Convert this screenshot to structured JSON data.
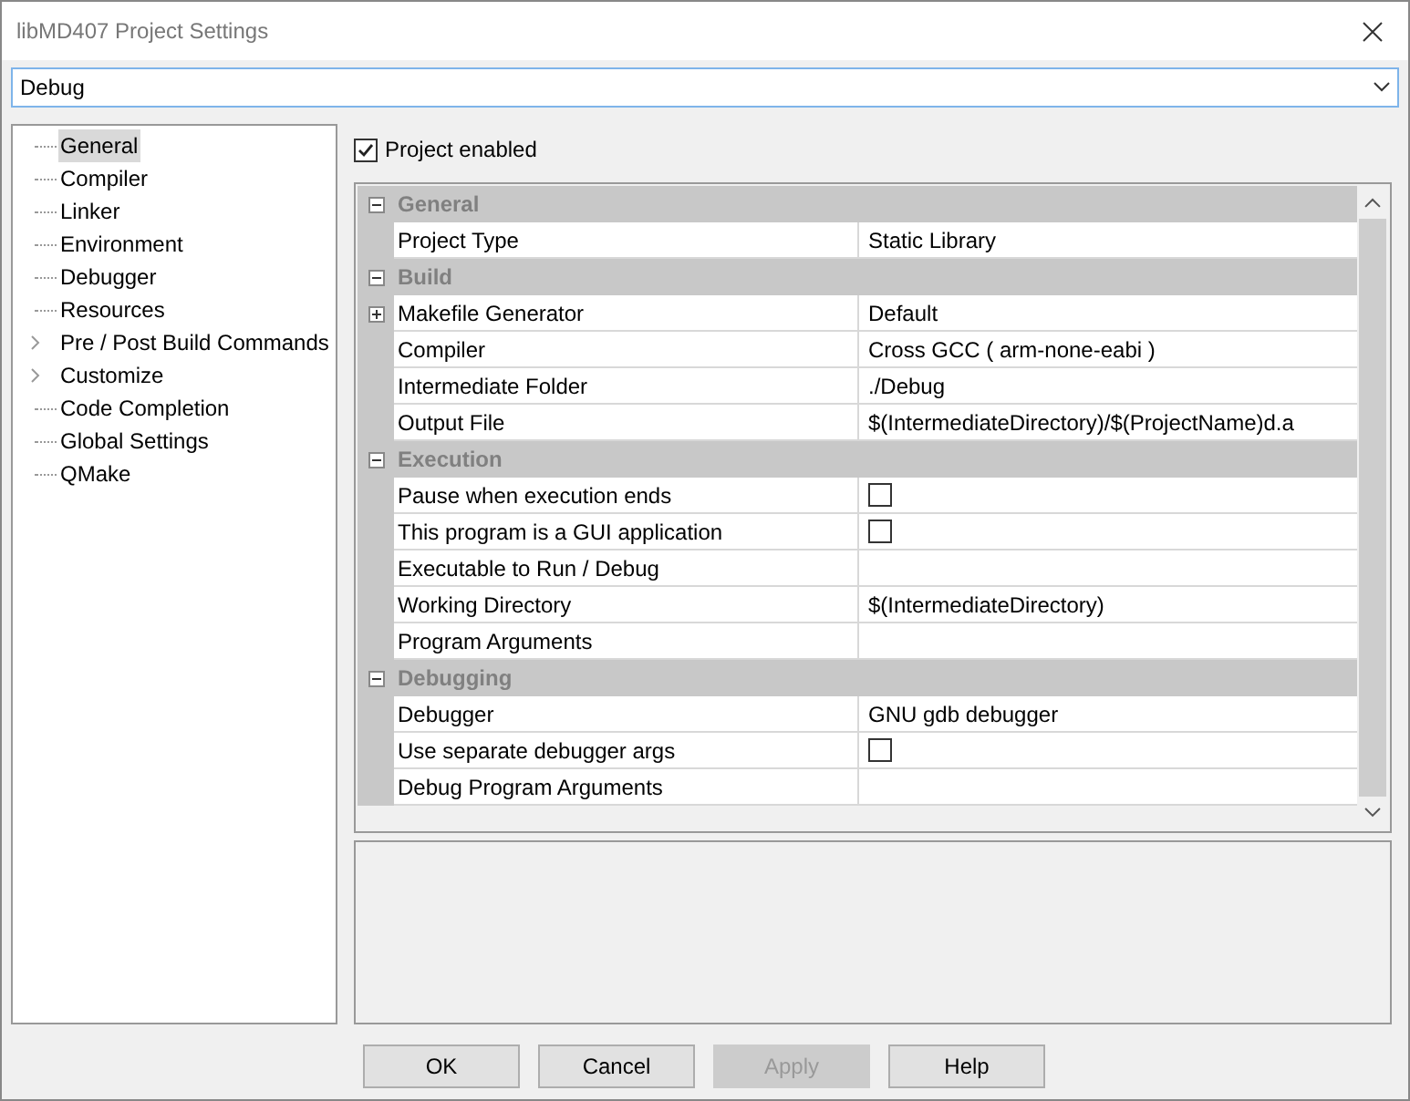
{
  "window": {
    "title": "libMD407 Project Settings"
  },
  "configuration": {
    "value": "Debug"
  },
  "tree": [
    {
      "label": "General",
      "selected": true,
      "expandable": false
    },
    {
      "label": "Compiler",
      "selected": false,
      "expandable": false
    },
    {
      "label": "Linker",
      "selected": false,
      "expandable": false
    },
    {
      "label": "Environment",
      "selected": false,
      "expandable": false
    },
    {
      "label": "Debugger",
      "selected": false,
      "expandable": false
    },
    {
      "label": "Resources",
      "selected": false,
      "expandable": false
    },
    {
      "label": "Pre / Post Build Commands",
      "selected": false,
      "expandable": true
    },
    {
      "label": "Customize",
      "selected": false,
      "expandable": true
    },
    {
      "label": "Code Completion",
      "selected": false,
      "expandable": false
    },
    {
      "label": "Global Settings",
      "selected": false,
      "expandable": false
    },
    {
      "label": "QMake",
      "selected": false,
      "expandable": false
    }
  ],
  "project_enabled": {
    "label": "Project enabled",
    "checked": true
  },
  "properties": [
    {
      "kind": "category",
      "name": "General",
      "expanded": true
    },
    {
      "kind": "text",
      "name": "Project Type",
      "value": "Static Library"
    },
    {
      "kind": "category",
      "name": "Build",
      "expanded": true
    },
    {
      "kind": "group",
      "name": "Makefile Generator",
      "value": "Default",
      "expanded": false
    },
    {
      "kind": "text",
      "name": "Compiler",
      "value": "Cross GCC ( arm-none-eabi )"
    },
    {
      "kind": "text",
      "name": "Intermediate Folder",
      "value": "./Debug"
    },
    {
      "kind": "text",
      "name": "Output File",
      "value": "$(IntermediateDirectory)/$(ProjectName)d.a"
    },
    {
      "kind": "category",
      "name": "Execution",
      "expanded": true
    },
    {
      "kind": "checkbox",
      "name": "Pause when execution ends",
      "checked": false
    },
    {
      "kind": "checkbox",
      "name": "This program is a GUI application",
      "checked": false
    },
    {
      "kind": "text",
      "name": "Executable to Run / Debug"
    },
    {
      "kind": "text",
      "name": "Working Directory",
      "value": "$(IntermediateDirectory)"
    },
    {
      "kind": "text",
      "name": "Program Arguments"
    },
    {
      "kind": "category",
      "name": "Debugging",
      "expanded": true
    },
    {
      "kind": "text",
      "name": "Debugger",
      "value": "GNU gdb debugger"
    },
    {
      "kind": "checkbox",
      "name": "Use separate debugger args",
      "checked": false
    },
    {
      "kind": "text",
      "name": "Debug Program Arguments"
    }
  ],
  "buttons": [
    {
      "label": "OK",
      "disabled": false
    },
    {
      "label": "Cancel",
      "disabled": false
    },
    {
      "label": "Apply",
      "disabled": true
    },
    {
      "label": "Help",
      "disabled": false
    }
  ]
}
